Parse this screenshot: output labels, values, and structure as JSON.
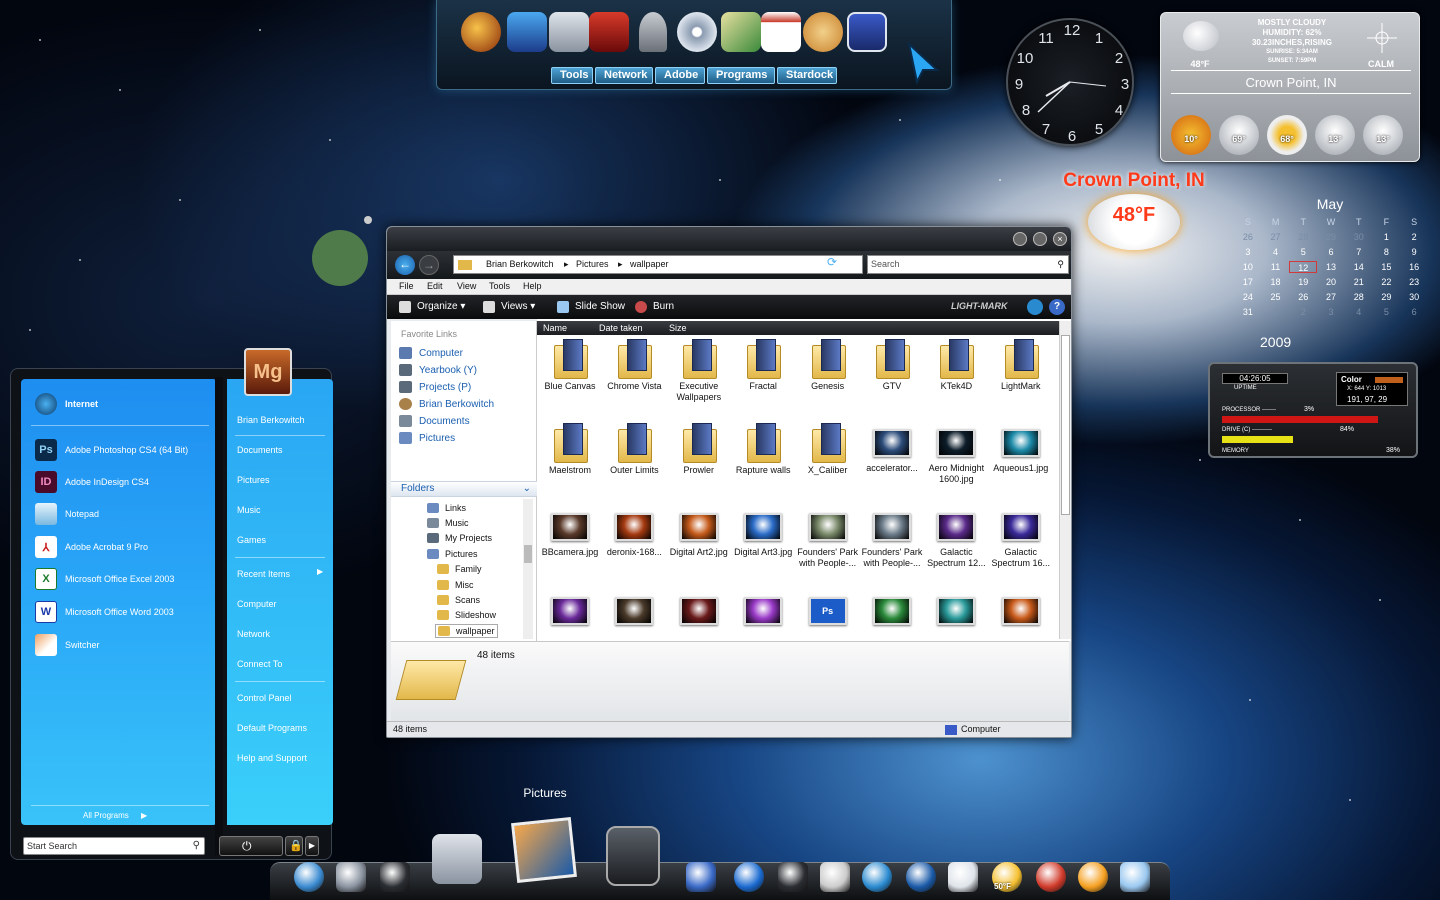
{
  "top_dock": {
    "icons": [
      "flash-icon",
      "monitor-icon",
      "cursor-icon",
      "book-icon",
      "upload-icon",
      "dvd-icon",
      "paint-icon",
      "calendar-check-icon",
      "palette-icon",
      "stardock-icon"
    ],
    "tabs": [
      "Tools",
      "Network",
      "Adobe",
      "Programs",
      "Stardock"
    ]
  },
  "clock": {
    "numbers": [
      "12",
      "1",
      "2",
      "3",
      "4",
      "5",
      "6",
      "7",
      "8",
      "9",
      "10",
      "11"
    ]
  },
  "weather": {
    "condition": "MOSTLY CLOUDY",
    "humidity": "HUMIDITY: 62%",
    "pressure": "30.23INCHES,RISING",
    "sunrise": "SUNRISE: 5:34AM",
    "sunset": "SUNSET: 7:59PM",
    "current_temp": "48°F",
    "wind": "CALM",
    "location": "Crown Point, IN",
    "forecast": [
      "10°",
      "69°",
      "68°",
      "13°",
      "13°"
    ]
  },
  "weather_badge": {
    "location": "Crown Point, IN",
    "temp": "48°F"
  },
  "calendar": {
    "month": "May",
    "year": "2009",
    "weekdays": [
      "S",
      "M",
      "T",
      "W",
      "T",
      "F",
      "S"
    ],
    "days": [
      "26",
      "27",
      "28",
      "29",
      "30",
      "1",
      "2",
      "3",
      "4",
      "5",
      "6",
      "7",
      "8",
      "9",
      "10",
      "11",
      "12",
      "13",
      "14",
      "15",
      "16",
      "17",
      "18",
      "19",
      "20",
      "21",
      "22",
      "23",
      "24",
      "25",
      "26",
      "27",
      "28",
      "29",
      "30",
      "31",
      "1",
      "2",
      "3",
      "4",
      "5",
      "6"
    ],
    "today": "12"
  },
  "sysmon": {
    "uptime": "04:26:05",
    "uptime_label": "UPTIME",
    "color_label": "Color",
    "coords": "X: 644  Y: 1013",
    "rgb": "191, 97, 29",
    "processor_label": "PROCESSOR -------",
    "processor_value": "3%",
    "processor_pct": 3,
    "drive_label": "DRIVE (C) ----------",
    "drive_value": "84%",
    "drive_pct": 84,
    "memory_label": "MEMORY",
    "memory_value": "38%",
    "memory_pct": 38
  },
  "start_menu": {
    "pinned": [
      {
        "label": "Internet",
        "icon": "globe-icon",
        "bold": true
      },
      {
        "label": "Adobe Photoshop CS4 (64 Bit)",
        "icon": "photoshop-icon",
        "abbr": "Ps"
      },
      {
        "label": "Adobe InDesign CS4",
        "icon": "indesign-icon",
        "abbr": "ID"
      },
      {
        "label": "Notepad",
        "icon": "notepad-icon",
        "abbr": ""
      },
      {
        "label": "Adobe Acrobat 9 Pro",
        "icon": "acrobat-icon",
        "abbr": ""
      },
      {
        "label": "Microsoft Office Excel 2003",
        "icon": "excel-icon",
        "abbr": "X"
      },
      {
        "label": "Microsoft Office Word 2003",
        "icon": "word-icon",
        "abbr": "W"
      },
      {
        "label": "Switcher",
        "icon": "switcher-icon",
        "abbr": ""
      }
    ],
    "all_programs": "All Programs",
    "search_placeholder": "Start Search",
    "user_tile_text": "Mg",
    "right_links": [
      "Brian Berkowitch",
      "Documents",
      "Pictures",
      "Music",
      "Games",
      "Recent Items",
      "Computer",
      "Network",
      "Connect To",
      "Control Panel",
      "Default Programs",
      "Help and Support"
    ]
  },
  "explorer": {
    "breadcrumb": [
      "Brian Berkowitch",
      "Pictures",
      "wallpaper"
    ],
    "search_placeholder": "Search",
    "menu": [
      "File",
      "Edit",
      "View",
      "Tools",
      "Help"
    ],
    "toolbar": {
      "organize": "Organize",
      "views": "Views",
      "slideshow": "Slide Show",
      "burn": "Burn",
      "brand": "LIGHT-MARK"
    },
    "favorite_links_title": "Favorite Links",
    "favorite_links": [
      "Computer",
      "Yearbook (Y)",
      "Projects (P)",
      "Brian Berkowitch",
      "Documents",
      "Pictures"
    ],
    "folders_title": "Folders",
    "tree": [
      "Links",
      "Music",
      "My Projects",
      "Pictures",
      "Family",
      "Misc",
      "Scans",
      "Slideshow",
      "wallpaper"
    ],
    "columns": [
      "Name",
      "Date taken",
      "Size"
    ],
    "items": [
      {
        "name": "Blue Canvas",
        "type": "folder"
      },
      {
        "name": "Chrome Vista",
        "type": "folder"
      },
      {
        "name": "Executive Wallpapers",
        "type": "folder"
      },
      {
        "name": "Fractal",
        "type": "folder"
      },
      {
        "name": "Genesis",
        "type": "folder"
      },
      {
        "name": "GTV",
        "type": "folder"
      },
      {
        "name": "KTek4D",
        "type": "folder"
      },
      {
        "name": "LightMark",
        "type": "folder"
      },
      {
        "name": "Maelstrom",
        "type": "folder"
      },
      {
        "name": "Outer Limits",
        "type": "folder"
      },
      {
        "name": "Prowler",
        "type": "folder"
      },
      {
        "name": "Rapture walls",
        "type": "folder"
      },
      {
        "name": "X_Caliber",
        "type": "folder"
      },
      {
        "name": "accelerator...",
        "type": "image",
        "color": "#2c4c7a"
      },
      {
        "name": "Aero Midnight 1600.jpg",
        "type": "image",
        "color": "#0d1d2a"
      },
      {
        "name": "Aqueous1.jpg",
        "type": "image",
        "color": "#1c8aa8"
      },
      {
        "name": "BBcamera.jpg",
        "type": "image",
        "color": "#5a3a2a"
      },
      {
        "name": "deronix-168...",
        "type": "image",
        "color": "#a53a10"
      },
      {
        "name": "Digital Art2.jpg",
        "type": "image",
        "color": "#c55a1a"
      },
      {
        "name": "Digital Art3.jpg",
        "type": "image",
        "color": "#2a6cc8"
      },
      {
        "name": "Founders' Park with People-...",
        "type": "image",
        "color": "#7a8a6a"
      },
      {
        "name": "Founders' Park with People-...",
        "type": "image",
        "color": "#6c7c8a"
      },
      {
        "name": "Galactic Spectrum 12...",
        "type": "image",
        "color": "#5a2a8a"
      },
      {
        "name": "Galactic Spectrum 16...",
        "type": "image",
        "color": "#3a2a9a"
      },
      {
        "name": "",
        "type": "image",
        "color": "#6a2a9a"
      },
      {
        "name": "",
        "type": "image",
        "color": "#4a3a2a"
      },
      {
        "name": "",
        "type": "image",
        "color": "#6a1a1a"
      },
      {
        "name": "",
        "type": "image",
        "color": "#9a3ac8"
      },
      {
        "name": "",
        "type": "psd",
        "color": "#1c5cc8"
      },
      {
        "name": "",
        "type": "image",
        "color": "#2a8a3a"
      },
      {
        "name": "",
        "type": "image",
        "color": "#2a9a9a"
      },
      {
        "name": "",
        "type": "image",
        "color": "#c85a1a"
      }
    ],
    "status_count": "48 items",
    "bottom_left": "48 items",
    "bottom_right": "Computer"
  },
  "bottom_dock": {
    "label": "Pictures",
    "icons": [
      "windows-orb-icon",
      "monitor-icon",
      "trash-icon",
      "film-icon",
      "pictures-icon",
      "usb-drive-icon",
      "music-icon",
      "media-play-icon",
      "gauge-icon",
      "scanner-icon",
      "internet-explorer-icon",
      "globe-icon",
      "mail-icon",
      "weather-sun-icon",
      "chrome-icon",
      "power-icon",
      "recycle-bin-icon"
    ],
    "weather_temp": "50°F"
  },
  "colors": {
    "accent": "#2aa6f3",
    "folder": "#e2b84a",
    "sysmon_red": "#d01515",
    "sysmon_yellow": "#e6e215"
  }
}
